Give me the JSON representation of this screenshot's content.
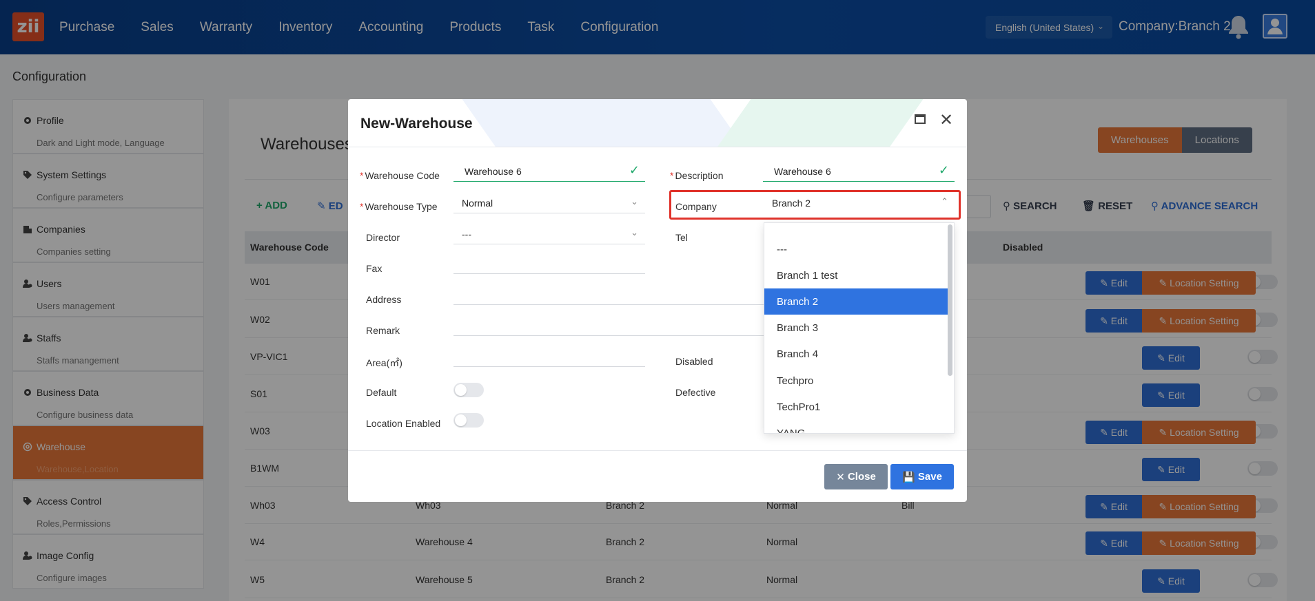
{
  "topbar": {
    "logo": "zii",
    "nav": [
      "Purchase",
      "Sales",
      "Warranty",
      "Inventory",
      "Accounting",
      "Products",
      "Task",
      "Configuration"
    ],
    "language": "English (United States)",
    "company": "Company:Branch 2"
  },
  "page": {
    "title": "Configuration"
  },
  "sidebar": {
    "items": [
      {
        "title": "Profile",
        "subtitle": "Dark and Light mode, Language",
        "icon": "gear-icon"
      },
      {
        "title": "System Settings",
        "subtitle": "Configure parameters",
        "icon": "tag-icon"
      },
      {
        "title": "Companies",
        "subtitle": "Companies setting",
        "icon": "building-icon"
      },
      {
        "title": "Users",
        "subtitle": "Users management",
        "icon": "user-gear-icon"
      },
      {
        "title": "Staffs",
        "subtitle": "Staffs manangement",
        "icon": "user-gear-icon"
      },
      {
        "title": "Business Data",
        "subtitle": "Configure business data",
        "icon": "gear-icon"
      },
      {
        "title": "Warehouse",
        "subtitle": "Warehouse,Location",
        "icon": "warehouse-icon"
      },
      {
        "title": "Access Control",
        "subtitle": "Roles,Permissions",
        "icon": "tag-icon"
      },
      {
        "title": "Image Config",
        "subtitle": "Configure images",
        "icon": "user-gear-icon"
      }
    ]
  },
  "main": {
    "title": "Warehouses",
    "tabs": [
      "Warehouses",
      "Locations"
    ],
    "toolbar": {
      "add": "ADD",
      "edit": "ED",
      "search": "SEARCH",
      "reset": "RESET",
      "advance": "ADVANCE SEARCH"
    },
    "columns": {
      "code": "Warehouse Code",
      "disabled": "Disabled"
    },
    "rows": [
      {
        "code": "W01",
        "name": "",
        "company": "",
        "type": "",
        "director": "",
        "loc": true
      },
      {
        "code": "W02",
        "name": "",
        "company": "",
        "type": "",
        "director": "",
        "loc": true
      },
      {
        "code": "VP-VIC1",
        "name": "",
        "company": "",
        "type": "",
        "director": "",
        "loc": false
      },
      {
        "code": "S01",
        "name": "",
        "company": "",
        "type": "",
        "director": "",
        "loc": false
      },
      {
        "code": "W03",
        "name": "",
        "company": "",
        "type": "",
        "director": "",
        "loc": true
      },
      {
        "code": "B1WM",
        "name": "",
        "company": "",
        "type": "",
        "director": "",
        "loc": false
      },
      {
        "code": "Wh03",
        "name": "Wh03",
        "company": "Branch 2",
        "type": "Normal",
        "director": "Bill",
        "loc": true
      },
      {
        "code": "W4",
        "name": "Warehouse 4",
        "company": "Branch 2",
        "type": "Normal",
        "director": "",
        "loc": true
      },
      {
        "code": "W5",
        "name": "Warehouse 5",
        "company": "Branch 2",
        "type": "Normal",
        "director": "",
        "loc": false
      }
    ],
    "edit_label": "Edit",
    "loc_label": "Location Setting"
  },
  "modal": {
    "title": "New-Warehouse",
    "warehouse_code_label": "Warehouse Code",
    "warehouse_code_value": "Warehouse 6",
    "description_label": "Description",
    "description_value": "Warehouse 6",
    "warehouse_type_label": "Warehouse Type",
    "warehouse_type_value": "Normal",
    "company_label": "Company",
    "company_value": "Branch 2",
    "director_label": "Director",
    "director_value": "---",
    "tel_label": "Tel",
    "fax_label": "Fax",
    "address_label": "Address",
    "remark_label": "Remark",
    "area_label": "Area(㎡)",
    "disabled_label": "Disabled",
    "default_label": "Default",
    "defective_label": "Defective",
    "location_enabled_label": "Location Enabled",
    "close_label": "Close",
    "save_label": "Save",
    "company_options": [
      "---",
      "Branch 1 test",
      "Branch 2",
      "Branch 3",
      "Branch 4",
      "Techpro",
      "TechPro1",
      "YANG"
    ],
    "selected_option": "Branch 2"
  }
}
